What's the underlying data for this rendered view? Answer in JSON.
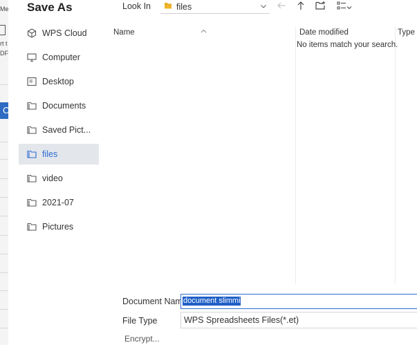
{
  "background_app": {
    "fragments": [
      "Me",
      "rt t",
      "DF"
    ]
  },
  "dialog": {
    "title": "Save As",
    "places": [
      {
        "label": "WPS Cloud",
        "icon": "cloud-hexagon-icon",
        "active": false
      },
      {
        "label": "Computer",
        "icon": "monitor-icon",
        "active": false
      },
      {
        "label": "Desktop",
        "icon": "desktop-icon",
        "active": false
      },
      {
        "label": "Documents",
        "icon": "folder-icon",
        "active": false
      },
      {
        "label": "Saved Pict...",
        "icon": "folder-icon",
        "active": false
      },
      {
        "label": "files",
        "icon": "folder-icon",
        "active": true
      },
      {
        "label": "video",
        "icon": "folder-icon",
        "active": false
      },
      {
        "label": "2021-07",
        "icon": "folder-icon",
        "active": false
      },
      {
        "label": "Pictures",
        "icon": "folder-icon",
        "active": false
      }
    ],
    "toolbar": {
      "look_in_label": "Look In",
      "look_in_value": "files",
      "back_icon": "arrow-left-icon",
      "up_icon": "arrow-up-icon",
      "new_folder_icon": "new-folder-icon",
      "view_icon": "view-list-icon"
    },
    "file_list": {
      "columns": [
        "Name",
        "Date modified",
        "Type"
      ],
      "empty_message": "No items match your search."
    },
    "form": {
      "document_name_label": "Document Name",
      "document_name_value": "document slimming",
      "file_type_label": "File Type",
      "file_type_value": "WPS Spreadsheets Files(*.et)",
      "encrypt_label": "Encrypt..."
    },
    "colors": {
      "accent": "#2e6bd1",
      "selection_bg": "#1f5fc7",
      "active_place_bg": "#e3e6eb",
      "folder_yellow": "#f0b429"
    }
  }
}
